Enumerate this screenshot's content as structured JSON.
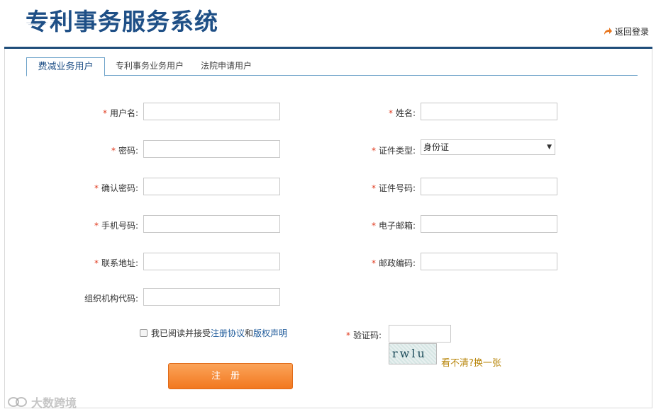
{
  "header": {
    "system_title": "专利事务服务系统",
    "back_link": "返回登录"
  },
  "tabs": [
    {
      "label": "费减业务用户",
      "active": true
    },
    {
      "label": "专利事务业务用户",
      "active": false
    },
    {
      "label": "法院申请用户",
      "active": false
    }
  ],
  "form": {
    "required_mark": "*",
    "left": [
      {
        "label": "用户名:",
        "required": true,
        "value": ""
      },
      {
        "label": "密码:",
        "required": true,
        "value": ""
      },
      {
        "label": "确认密码:",
        "required": true,
        "value": ""
      },
      {
        "label": "手机号码:",
        "required": true,
        "value": ""
      },
      {
        "label": "联系地址:",
        "required": true,
        "value": ""
      },
      {
        "label": "组织机构代码:",
        "required": false,
        "value": ""
      }
    ],
    "right": [
      {
        "label": "姓名:",
        "required": true,
        "value": ""
      },
      {
        "label": "证件类型:",
        "required": true,
        "value": "身份证"
      },
      {
        "label": "证件号码:",
        "required": true,
        "value": ""
      },
      {
        "label": "电子邮箱:",
        "required": true,
        "value": ""
      },
      {
        "label": "邮政编码:",
        "required": true,
        "value": ""
      }
    ],
    "agreement": {
      "prefix": "我已阅读并接受",
      "link1": "注册协议",
      "middle": "和",
      "link2": "版权声明",
      "checked": false
    },
    "captcha": {
      "label": "验证码:",
      "value": "",
      "image_text": "rwlu",
      "refresh": "看不清?换一张"
    },
    "submit": "注册"
  },
  "watermark": "大数跨境",
  "colors": {
    "brand_blue": "#1e4f86",
    "header_line": "#1f4d7a",
    "required_red": "#e03a1e",
    "button_orange": "#f2781f",
    "link_blue": "#1e5a9a",
    "refresh_gold": "#b8860b"
  }
}
